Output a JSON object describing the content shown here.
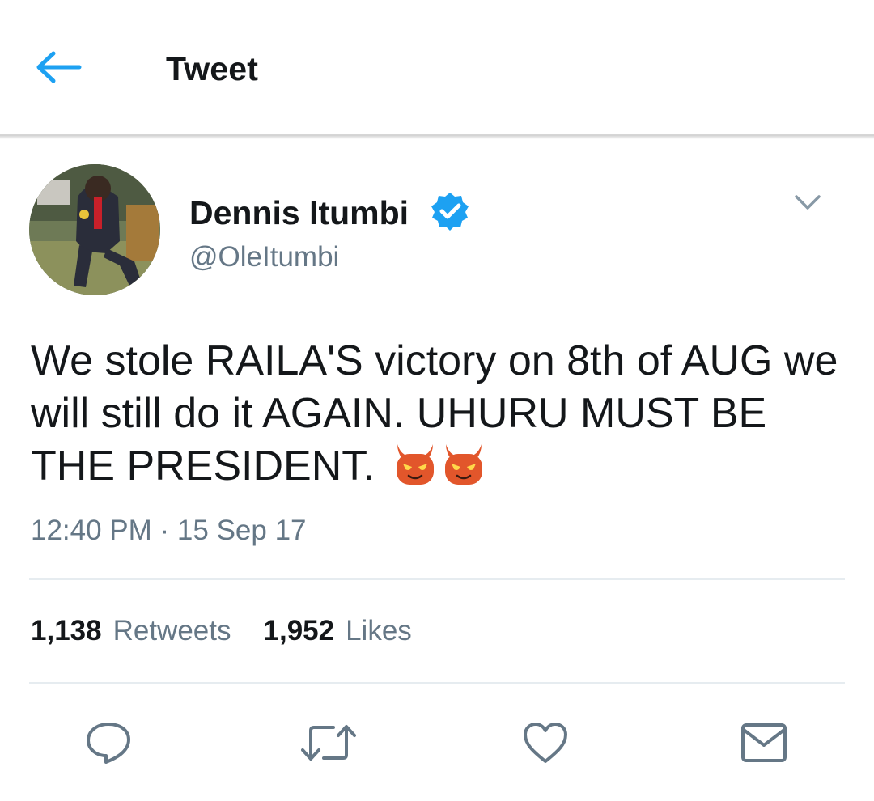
{
  "header": {
    "title": "Tweet",
    "back_icon": "arrow-left-icon",
    "accent": "#1da1f2"
  },
  "author": {
    "display_name": "Dennis Itumbi",
    "handle": "@OleItumbi",
    "verified_icon": "verified-badge-icon",
    "menu_icon": "chevron-down-icon"
  },
  "tweet": {
    "text": "We stole RAILA'S victory on 8th of AUG we will still do it AGAIN. UHURU MUST BE THE PRESIDENT.",
    "emojis": [
      "smiling-imp-emoji",
      "smiling-imp-emoji"
    ],
    "timestamp": "12:40 PM · 15 Sep 17"
  },
  "stats": {
    "retweets_count": "1,138",
    "retweets_label": "Retweets",
    "likes_count": "1,952",
    "likes_label": "Likes"
  },
  "actions": [
    "reply-icon",
    "retweet-icon",
    "like-icon",
    "direct-message-icon"
  ],
  "colors": {
    "text": "#14171a",
    "secondary": "#657786",
    "divider": "#e6ecf0",
    "verified": "#1da1f2",
    "emoji": "#e2562b"
  }
}
